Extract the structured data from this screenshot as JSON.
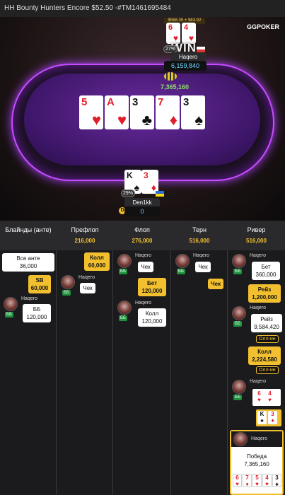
{
  "header": {
    "title": "HH Bounty Hunters Encore $52.50 -#TM1461695484"
  },
  "logo": {
    "gg": "GG",
    "poker": "POKER"
  },
  "table": {
    "bounty_strip": "$568.35 + $63.92",
    "win_label": "WIN",
    "villain": {
      "name": "Haqero",
      "stack": "6,159,840",
      "equity": "27%",
      "cards": [
        {
          "rank": "6",
          "suit": "♥",
          "color": "red"
        },
        {
          "rank": "4",
          "suit": "♥",
          "color": "red"
        }
      ]
    },
    "pot": "7,365,160",
    "board": [
      {
        "rank": "5",
        "suit": "♥",
        "color": "red"
      },
      {
        "rank": "A",
        "suit": "♥",
        "color": "red"
      },
      {
        "rank": "3",
        "suit": "♣",
        "color": "blk"
      },
      {
        "rank": "7",
        "suit": "♦",
        "color": "red"
      },
      {
        "rank": "3",
        "suit": "♠",
        "color": "blk"
      }
    ],
    "hero": {
      "name": "Den1kk",
      "stack": "0",
      "equity": "29%",
      "cards": [
        {
          "rank": "K",
          "suit": "♠",
          "color": "blk"
        },
        {
          "rank": "3",
          "suit": "♦",
          "color": "red"
        }
      ]
    }
  },
  "streets": [
    {
      "label": "Блайнды (анте)",
      "pot": ""
    },
    {
      "label": "Префлоп",
      "pot": "216,000"
    },
    {
      "label": "Флоп",
      "pot": "276,000"
    },
    {
      "label": "Терн",
      "pot": "516,000"
    },
    {
      "label": "Ривер",
      "pot": "516,000"
    }
  ],
  "blinds": {
    "ante_line1": "Все анте",
    "ante_line2": "36,000",
    "sb_line1": "SB",
    "sb_line2": "60,000",
    "player": "Haqero",
    "bb_tag": "ББ",
    "bb_line1": "ББ",
    "bb_line2": "120,000"
  },
  "preflop": {
    "call_line1": "Колл",
    "call_line2": "60,000",
    "player": "Haqero",
    "bb_tag": "ББ",
    "check": "Чек"
  },
  "flop": {
    "player1": "Haqero",
    "bb_tag1": "ББ",
    "check": "Чек",
    "bet_line1": "Бет",
    "bet_line2": "120,000",
    "player2": "Haqero",
    "bb_tag2": "ББ",
    "call_line1": "Колл",
    "call_line2": "120,000"
  },
  "turn": {
    "player": "Haqero",
    "bb_tag": "ББ",
    "check1": "Чек",
    "check2": "Чек"
  },
  "river": {
    "player1": "Haqero",
    "bb_tag1": "ББ",
    "bet_line1": "Бет",
    "bet_line2": "360,000",
    "raise1_line1": "Рейз",
    "raise1_line2": "1,200,000",
    "player2": "Haqero",
    "bb_tag2": "ББ",
    "raise2_line1": "Рейз",
    "raise2_line2": "9,584,420",
    "allin1": "Олл-ин",
    "call_line1": "Колл",
    "call_line2": "2,224,580",
    "allin2": "Олл-ин",
    "player3": "Haqero",
    "bb_tag3": "ББ",
    "show_villain": [
      {
        "rank": "6",
        "suit": "♥"
      },
      {
        "rank": "4",
        "suit": "♥"
      }
    ],
    "show_hero": [
      {
        "rank": "K",
        "suit": "♠"
      },
      {
        "rank": "3",
        "suit": "♦"
      }
    ],
    "winner": "Haqero",
    "win_line1": "Победа",
    "win_line2": "7,365,160",
    "win_cards": [
      {
        "rank": "6",
        "suit": "♥"
      },
      {
        "rank": "7",
        "suit": "♦"
      },
      {
        "rank": "5",
        "suit": "♥"
      },
      {
        "rank": "4",
        "suit": "♥"
      },
      {
        "rank": "3",
        "suit": "♠"
      }
    ]
  }
}
